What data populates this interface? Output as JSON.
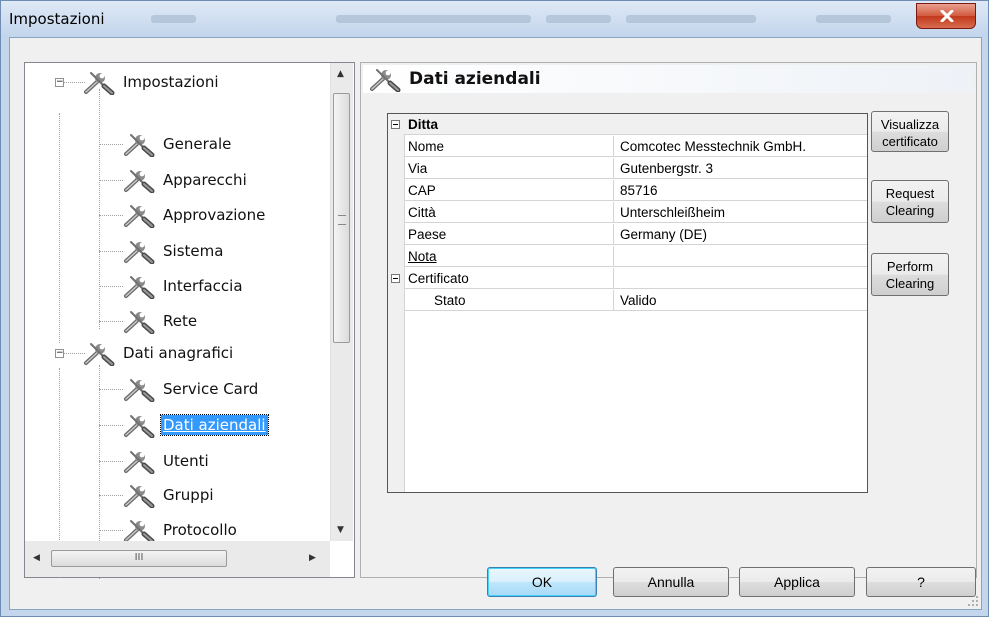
{
  "window": {
    "title": "Impostazioni"
  },
  "tree": {
    "items": [
      {
        "label": "Impostazioni",
        "level": 0,
        "expanded": true
      },
      {
        "label": "Generale",
        "level": 1
      },
      {
        "label": "Apparecchi",
        "level": 1
      },
      {
        "label": "Approvazione",
        "level": 1
      },
      {
        "label": "Sistema",
        "level": 1
      },
      {
        "label": "Interfaccia",
        "level": 1
      },
      {
        "label": "Rete",
        "level": 1
      },
      {
        "label": "Dati anagrafici",
        "level": 0,
        "expanded": true
      },
      {
        "label": "Service Card",
        "level": 1
      },
      {
        "label": "Dati aziendali",
        "level": 1,
        "selected": true
      },
      {
        "label": "Utenti",
        "level": 1
      },
      {
        "label": "Gruppi",
        "level": 1
      },
      {
        "label": "Protocollo",
        "level": 1
      }
    ],
    "hscroll_thumb_label": "III"
  },
  "panel": {
    "title": "Dati aziendali",
    "grid": {
      "category1": "Ditta",
      "rows1": [
        {
          "key": "Nome",
          "value": "Comcotec Messtechnik GmbH."
        },
        {
          "key": "Via",
          "value": "Gutenbergstr. 3"
        },
        {
          "key": "CAP",
          "value": "85716"
        },
        {
          "key": "Città",
          "value": "Unterschleißheim"
        },
        {
          "key": "Paese",
          "value": "Germany (DE)"
        },
        {
          "key": "Nota",
          "value": ""
        }
      ],
      "category2": "Certificato",
      "rows2": [
        {
          "key": "Stato",
          "value": "Valido"
        }
      ]
    },
    "side_buttons": {
      "view_cert_line1": "Visualizza",
      "view_cert_line2": "certificato",
      "request_line1": "Request",
      "request_line2": "Clearing",
      "perform_line1": "Perform",
      "perform_line2": "Clearing"
    }
  },
  "footer": {
    "ok": "OK",
    "cancel": "Annulla",
    "apply": "Applica",
    "help": "?"
  },
  "colors": {
    "selection": "#3399ff",
    "default_button_border": "#3c7fb1",
    "close_button": "#c2381c"
  },
  "icons": {
    "tree_item": "tools-icon",
    "close": "close-icon"
  }
}
